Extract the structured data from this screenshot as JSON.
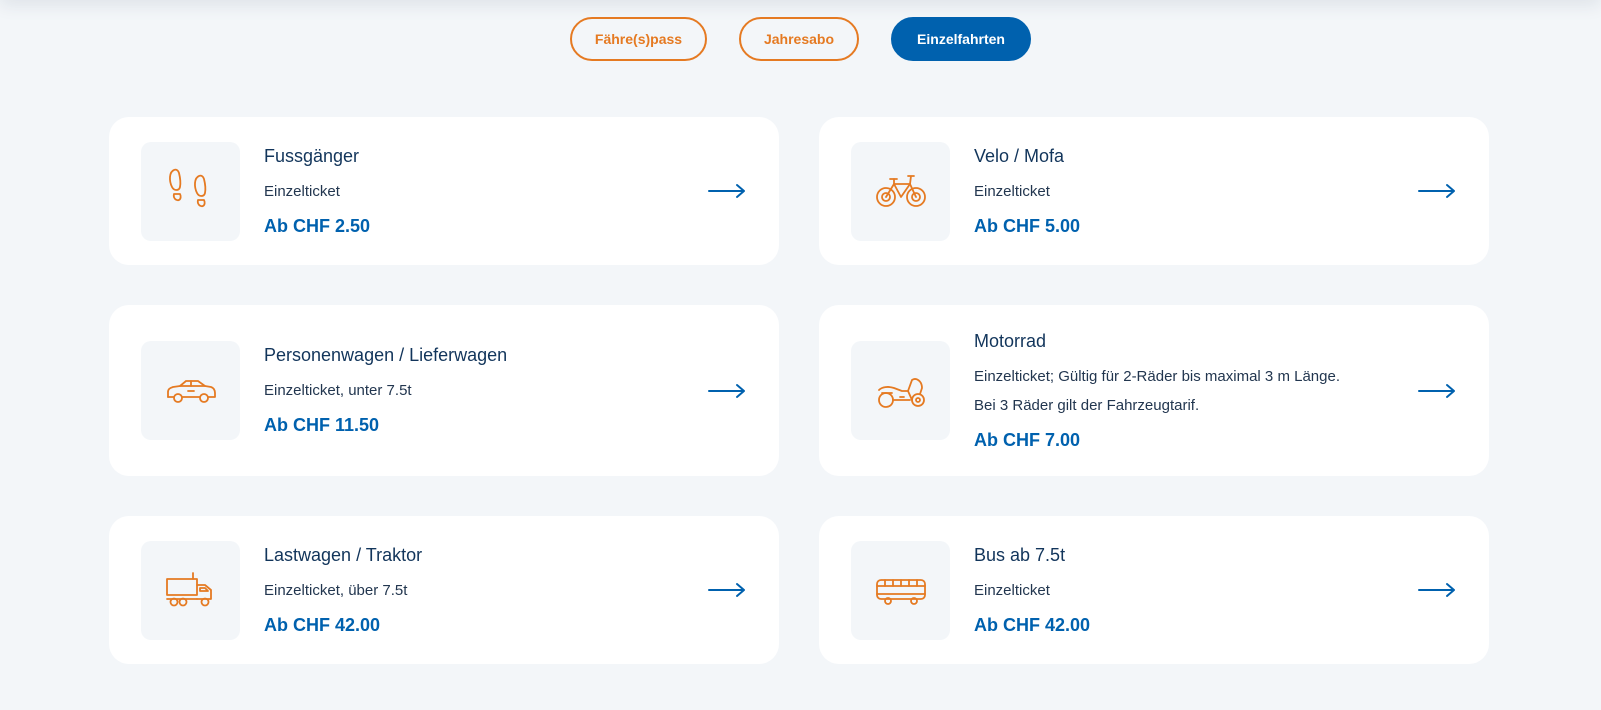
{
  "tabs": [
    {
      "label": "Fähre(s)pass",
      "active": false
    },
    {
      "label": "Jahresabo",
      "active": false
    },
    {
      "label": "Einzelfahrten",
      "active": true
    }
  ],
  "cards": [
    {
      "title": "Fussgänger",
      "lines": [
        "Einzelticket"
      ],
      "price": "Ab CHF 2.50",
      "icon": "footprints-icon"
    },
    {
      "title": "Velo / Mofa",
      "lines": [
        "Einzelticket"
      ],
      "price": "Ab CHF 5.00",
      "icon": "bicycle-icon"
    },
    {
      "title": "Personenwagen / Lieferwagen",
      "lines": [
        "Einzelticket, unter 7.5t"
      ],
      "price": "Ab CHF 11.50",
      "icon": "car-icon"
    },
    {
      "title": "Motorrad",
      "lines": [
        "Einzelticket; Gültig für 2-Räder bis maximal 3 m Länge.",
        "Bei 3 Räder gilt der Fahrzeugtarif."
      ],
      "price": "Ab CHF 7.00",
      "icon": "motorcycle-icon"
    },
    {
      "title": "Lastwagen / Traktor",
      "lines": [
        "Einzelticket, über 7.5t"
      ],
      "price": "Ab CHF 42.00",
      "icon": "truck-icon"
    },
    {
      "title": "Bus ab 7.5t",
      "lines": [
        "Einzelticket"
      ],
      "price": "Ab CHF 42.00",
      "icon": "bus-icon"
    }
  ],
  "colors": {
    "accent_orange": "#e57a22",
    "primary_blue": "#0061ae",
    "page_background": "#f3f6f9"
  }
}
